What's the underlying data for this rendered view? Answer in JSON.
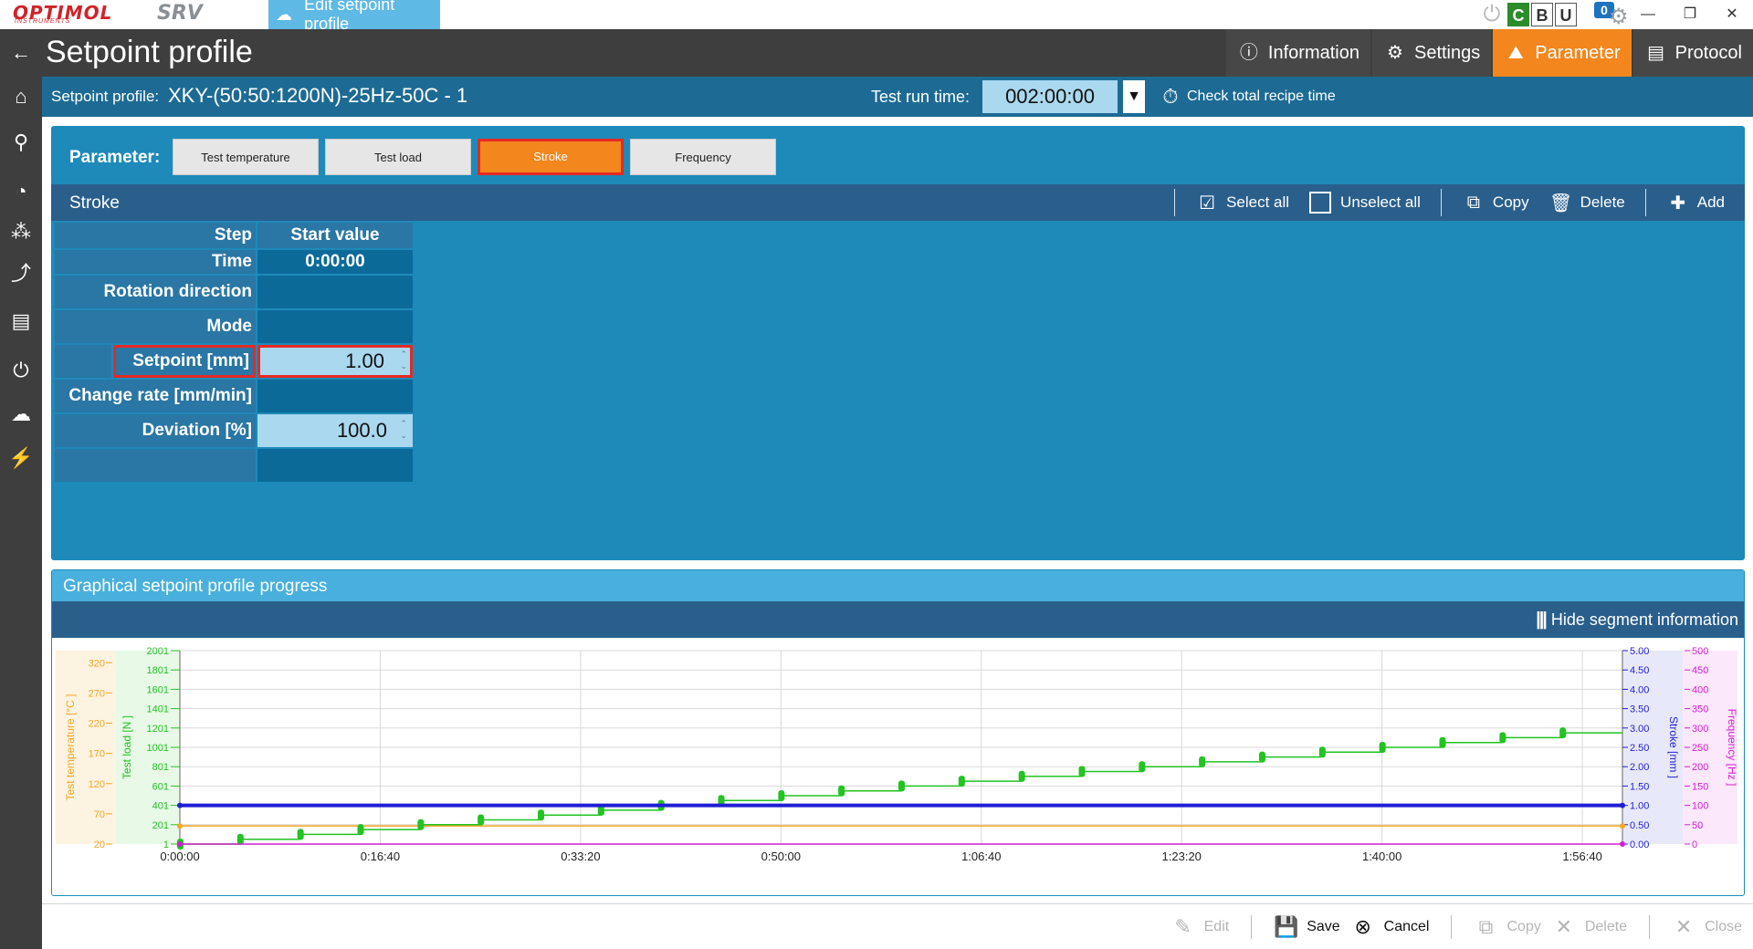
{
  "topbar": {
    "logo_main": "OPTIMOL",
    "logo_sub": "INSTRUMENTS",
    "logo_srv": "SRV",
    "active_tab": "Edit setpoint profile",
    "cbu": [
      "C",
      "B",
      "U"
    ],
    "notification_count": "0"
  },
  "header": {
    "title": "Setpoint profile",
    "tabs": [
      {
        "label": "Information",
        "icon": "info-icon"
      },
      {
        "label": "Settings",
        "icon": "settings-icon"
      },
      {
        "label": "Parameter",
        "icon": "chart-icon",
        "active": true
      },
      {
        "label": "Protocol",
        "icon": "document-icon"
      }
    ]
  },
  "infobar": {
    "profile_label": "Setpoint profile:",
    "profile_value": "XKY-(50:50:1200N)-25Hz-50C - 1",
    "run_time_label": "Test run time:",
    "run_time_value": "002:00:00",
    "check_label": "Check total recipe time"
  },
  "parameter": {
    "label": "Parameter:",
    "buttons": [
      "Test temperature",
      "Test load",
      "Stroke",
      "Frequency"
    ],
    "active": "Stroke"
  },
  "stroke_bar": {
    "title": "Stroke",
    "select_all": "Select all",
    "unselect_all": "Unselect all",
    "copy": "Copy",
    "delete": "Delete",
    "add": "Add"
  },
  "table": {
    "rows": [
      {
        "label": "Step",
        "value": "Start value"
      },
      {
        "label": "Time",
        "value": "0:00:00"
      },
      {
        "label": "Rotation direction",
        "value": ""
      },
      {
        "label": "Mode",
        "value": ""
      },
      {
        "label": "Setpoint [mm]",
        "value": "1.00"
      },
      {
        "label": "Change rate [mm/min]",
        "value": ""
      },
      {
        "label": "Deviation [%]",
        "value": "100.0"
      },
      {
        "label": "",
        "value": ""
      }
    ]
  },
  "graph": {
    "title": "Graphical setpoint profile progress",
    "hide_segment": "Hide segment information"
  },
  "chart_data": {
    "type": "line",
    "x_ticks": [
      "0:00:00",
      "0:16:40",
      "0:33:20",
      "0:50:00",
      "1:06:40",
      "1:23:20",
      "1:40:00",
      "1:56:40"
    ],
    "xlim_seconds": [
      0,
      7200
    ],
    "axes": {
      "temp": {
        "label": "Test temperature [°C ]",
        "ticks": [
          "320",
          "270",
          "220",
          "170",
          "120",
          "70",
          "20"
        ],
        "ylim": [
          20,
          340
        ],
        "color": "#f5a623"
      },
      "load": {
        "label": "Test load [N ]",
        "ticks": [
          "2001",
          "1801",
          "1601",
          "1401",
          "1201",
          "1001",
          "801",
          "601",
          "401",
          "201",
          "1"
        ],
        "ylim": [
          1,
          2001
        ],
        "color": "#22c322"
      },
      "stroke": {
        "label": "Stroke [mm ]",
        "ticks": [
          "5.00",
          "4.50",
          "4.00",
          "3.50",
          "3.00",
          "2.50",
          "2.00",
          "1.50",
          "1.00",
          "0.50",
          "0.00"
        ],
        "ylim": [
          0,
          5
        ],
        "color": "#1f1fd4"
      },
      "freq": {
        "label": "Frequency [Hz ]",
        "ticks": [
          "500",
          "450",
          "400",
          "350",
          "300",
          "250",
          "200",
          "150",
          "100",
          "50",
          "0"
        ],
        "ylim": [
          0,
          500
        ],
        "color": "#d21fd2"
      }
    },
    "series": [
      {
        "name": "Test temperature",
        "axis": "temp",
        "color": "#f5a623",
        "values": [
          [
            0,
            50
          ],
          [
            7200,
            50
          ]
        ]
      },
      {
        "name": "Test load",
        "axis": "load",
        "color": "#22c322",
        "step_seconds": 300,
        "step_load": 50,
        "max_load": 1200
      },
      {
        "name": "Stroke",
        "axis": "stroke",
        "color": "#1f1fd4",
        "values": [
          [
            0,
            1.0
          ],
          [
            7200,
            1.0
          ]
        ]
      },
      {
        "name": "Frequency",
        "axis": "freq",
        "color": "#d21fd2",
        "values": [
          [
            0,
            0
          ],
          [
            7200,
            0
          ]
        ]
      }
    ]
  },
  "bottombar": {
    "edit": "Edit",
    "save": "Save",
    "cancel": "Cancel",
    "copy": "Copy",
    "delete": "Delete",
    "close": "Close"
  }
}
